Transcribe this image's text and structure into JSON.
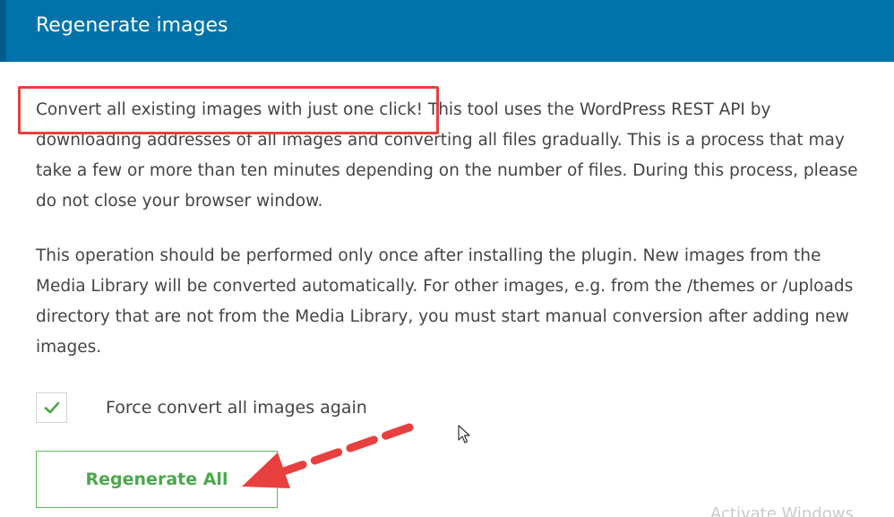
{
  "header": {
    "title": "Regenerate images"
  },
  "description": {
    "paragraph1": "Convert all existing images with just one click! This tool uses the WordPress REST API by downloading addresses of all images and converting all files gradually. This is a process that may take a few or more than ten minutes depending on the number of files. During this process, please do not close your browser window.",
    "paragraph2": "This operation should be performed only once after installing the plugin. New images from the Media Library will be converted automatically. For other images, e.g. from the /themes or /uploads directory that are not from the Media Library, you must start manual conversion after adding new images."
  },
  "force_convert": {
    "checked": true,
    "label": "Force convert all images again"
  },
  "regenerate_button": {
    "label": "Regenerate All"
  },
  "watermark": {
    "text": "Activate Windows"
  },
  "colors": {
    "header_bg": "#0073aa",
    "button_accent": "#5cb85c",
    "annotation_red": "#e8403f"
  },
  "icons": {
    "checkbox_mark": "checkmark-icon",
    "cursor": "mouse-pointer-icon",
    "annotation_arrow": "dashed-arrow-icon"
  }
}
